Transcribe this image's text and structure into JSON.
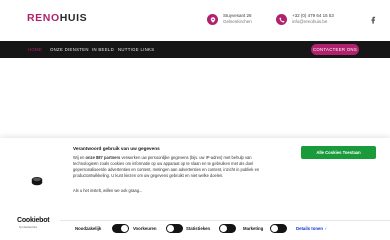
{
  "header": {
    "logo_part1": "RENO",
    "logo_part2": "HUIS",
    "address_line1": "Stuyvesant 26",
    "address_line2": "Gelsenkirchen",
    "phone_line1": "+32 (0) 479 64 15 53",
    "phone_line2": "info@renohuis.be",
    "social_icon": "facebook-icon"
  },
  "nav": {
    "items": [
      {
        "label": "Home",
        "active": true
      },
      {
        "label": "Onze diensten",
        "active": false
      },
      {
        "label": "In beeld",
        "active": false
      },
      {
        "label": "Nuttige links",
        "active": false
      }
    ],
    "contact_button": "Contacteer ons"
  },
  "cookie": {
    "title": "Verantwoord gebruik van uw gegevens",
    "body_pre": "Wij en ",
    "body_partners": "onze 887 partners",
    "body_post": " verwerken uw persoonlijke gegevens (bijv. uw IP-adres) met behulp van technologieën zoals cookies om informatie op uw apparaat op te slaan en te gebruiken met als doel gepersonaliseerde advertenties en content, metingen aan advertenties en content, inzicht in publiek en productontwikkeling. U kunt kiezen om uw gegevens gebruikt en niet welke doelen.",
    "more_text": "Als u het instelt, willen we ook graag...",
    "accept_button": "Alle Cookies Toestaan",
    "brand_name": "Cookiebot",
    "brand_by": "by Usercentrics",
    "toggles": [
      {
        "label": "Noodzakelijk",
        "on": true
      },
      {
        "label": "Voorkeuren",
        "on": false
      },
      {
        "label": "Statistieken",
        "on": false
      },
      {
        "label": "Marketing",
        "on": false
      }
    ],
    "details_link": "Details tonen",
    "accent": "#1a9b3b",
    "link_color": "#1032cf"
  },
  "colors": {
    "brand": "#b0226e",
    "nav_bg": "#161616"
  }
}
